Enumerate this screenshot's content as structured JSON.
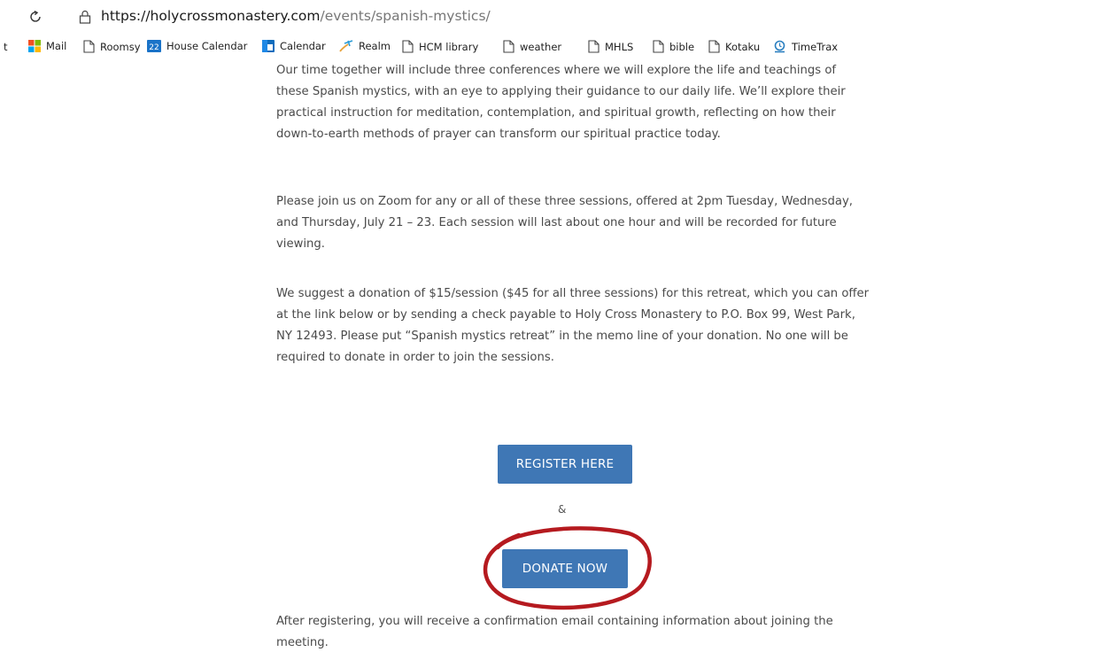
{
  "browser": {
    "url_host": "https://holycrossmonastery.com",
    "url_path": "/events/spanish-mystics/"
  },
  "bookmarks": {
    "cut_label": "t",
    "items": [
      {
        "label": "Mail",
        "icon": "microsoft-icon"
      },
      {
        "label": "Roomsy",
        "icon": "page-icon"
      },
      {
        "label": "House Calendar",
        "icon": "calendar-22-icon",
        "badge": "22"
      },
      {
        "label": "Calendar",
        "icon": "calendar-icon"
      },
      {
        "label": "Realm",
        "icon": "realm-icon"
      },
      {
        "label": "HCM library",
        "icon": "page-icon"
      },
      {
        "label": "weather",
        "icon": "page-icon"
      },
      {
        "label": "MHLS",
        "icon": "page-icon"
      },
      {
        "label": "bible",
        "icon": "page-icon"
      },
      {
        "label": "Kotaku",
        "icon": "page-icon"
      },
      {
        "label": "TimeTrax",
        "icon": "timetrax-icon"
      }
    ]
  },
  "content": {
    "p1": "Our time together will include three conferences where we will explore the life and teachings of these Spanish mystics, with an eye to applying their guidance to our daily life. We’ll explore their practical instruction for meditation, contemplation, and spiritual growth, reflecting on how their down-to-earth methods of prayer can transform our spiritual practice today.",
    "p2": "Please join us on Zoom for any or all of these three sessions, offered at 2pm Tuesday, Wednesday, and Thursday, July 21 – 23. Each session will last about one hour and will be recorded for future viewing.",
    "p3": "We suggest a donation of $15/session ($45 for all three sessions) for this retreat, which you can offer at the link below or by sending a check payable to Holy Cross Monastery to P.O. Box 99, West Park, NY 12493. Please put “Spanish mystics retreat” in the memo line of your donation. No one will be required to donate in order to join the sessions.",
    "register_label": "REGISTER HERE",
    "amp": "&",
    "donate_label": "DONATE NOW",
    "after": "After registering, you will receive a confirmation email containing information about joining the meeting."
  },
  "colors": {
    "button": "#3f77b5",
    "annotation_circle": "#b51a1f"
  }
}
